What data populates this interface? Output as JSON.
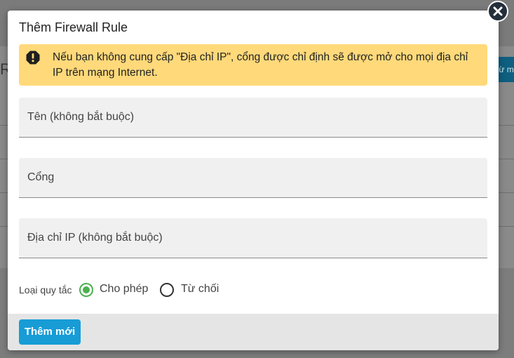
{
  "background": {
    "letter": "R",
    "button_label": "Từ m"
  },
  "modal": {
    "title": "Thêm Firewall Rule",
    "alert_text": "Nếu bạn không cung cấp \"Địa chỉ IP\", cổng được chỉ định sẽ được mở cho mọi địa chỉ IP trên mạng Internet.",
    "fields": {
      "name_label": "Tên (không bắt buộc)",
      "port_label": "Cổng",
      "ip_label": "Địa chỉ IP (không bắt buộc)"
    },
    "rule_type": {
      "label": "Loại quy tắc",
      "options": [
        {
          "label": "Cho phép",
          "selected": true
        },
        {
          "label": "Từ chối",
          "selected": false
        }
      ]
    },
    "submit_label": "Thêm mới"
  },
  "colors": {
    "alert_bg": "#ffd97a",
    "primary": "#179cd6",
    "radio_selected": "#4caf50"
  }
}
